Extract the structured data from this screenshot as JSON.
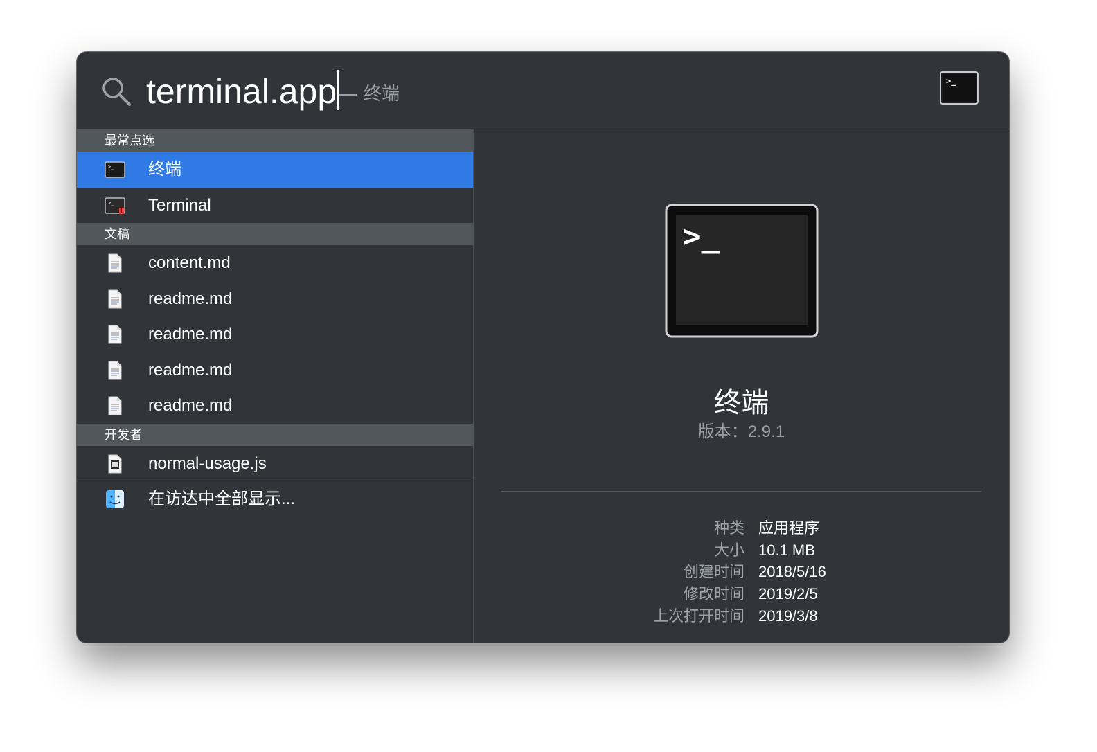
{
  "search": {
    "query": "terminal.app",
    "suggestion": "终端",
    "top_icon": "terminal-icon"
  },
  "sections": [
    {
      "header": "最常点选",
      "items": [
        {
          "label": "终端",
          "icon": "terminal-icon",
          "selected": true
        },
        {
          "label": "Terminal",
          "icon": "terminal-app-icon",
          "selected": false
        }
      ]
    },
    {
      "header": "文稿",
      "items": [
        {
          "label": "content.md",
          "icon": "document-icon"
        },
        {
          "label": "readme.md",
          "icon": "document-icon"
        },
        {
          "label": "readme.md",
          "icon": "document-icon"
        },
        {
          "label": "readme.md",
          "icon": "document-icon"
        },
        {
          "label": "readme.md",
          "icon": "document-icon"
        }
      ]
    },
    {
      "header": "开发者",
      "items": [
        {
          "label": "normal-usage.js",
          "icon": "js-file-icon"
        }
      ]
    }
  ],
  "footer_item": {
    "label": "在访达中全部显示...",
    "icon": "finder-icon"
  },
  "detail": {
    "name": "终端",
    "version": "版本：2.9.1",
    "prompt_glyph": ">_",
    "meta": [
      {
        "key": "种类",
        "value": "应用程序"
      },
      {
        "key": "大小",
        "value": "10.1 MB"
      },
      {
        "key": "创建时间",
        "value": "2018/5/16"
      },
      {
        "key": "修改时间",
        "value": "2019/2/5"
      },
      {
        "key": "上次打开时间",
        "value": "2019/3/8"
      }
    ]
  },
  "colors": {
    "window_bg": "#313539",
    "section_header_bg": "#52575c",
    "selection": "#2f7ae5",
    "secondary_text": "#9da2a6"
  }
}
